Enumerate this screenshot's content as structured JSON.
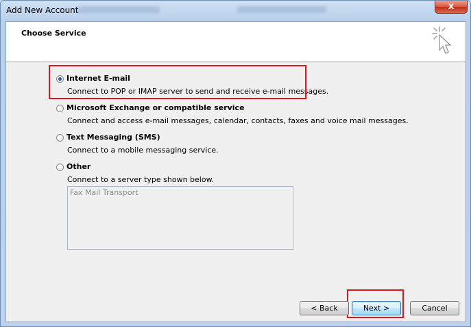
{
  "window": {
    "title": "Add New Account",
    "close_label": "x"
  },
  "header": {
    "title": "Choose Service"
  },
  "options": [
    {
      "label": "Internet E-mail",
      "description": "Connect to POP or IMAP server to send and receive e-mail messages.",
      "selected": true
    },
    {
      "label": "Microsoft Exchange or compatible service",
      "description": "Connect and access e-mail messages, calendar, contacts, faxes and voice mail messages.",
      "selected": false
    },
    {
      "label": "Text Messaging (SMS)",
      "description": "Connect to a mobile messaging service.",
      "selected": false
    },
    {
      "label": "Other",
      "description": "Connect to a server type shown below.",
      "selected": false
    }
  ],
  "other_list": {
    "items": [
      "Fax Mail Transport"
    ]
  },
  "buttons": {
    "back": "< Back",
    "next": "Next >",
    "cancel": "Cancel"
  },
  "colors": {
    "highlight": "#e3141c",
    "selected_radio": "#2a5ea0",
    "title_bar": "#cfe0f3"
  }
}
